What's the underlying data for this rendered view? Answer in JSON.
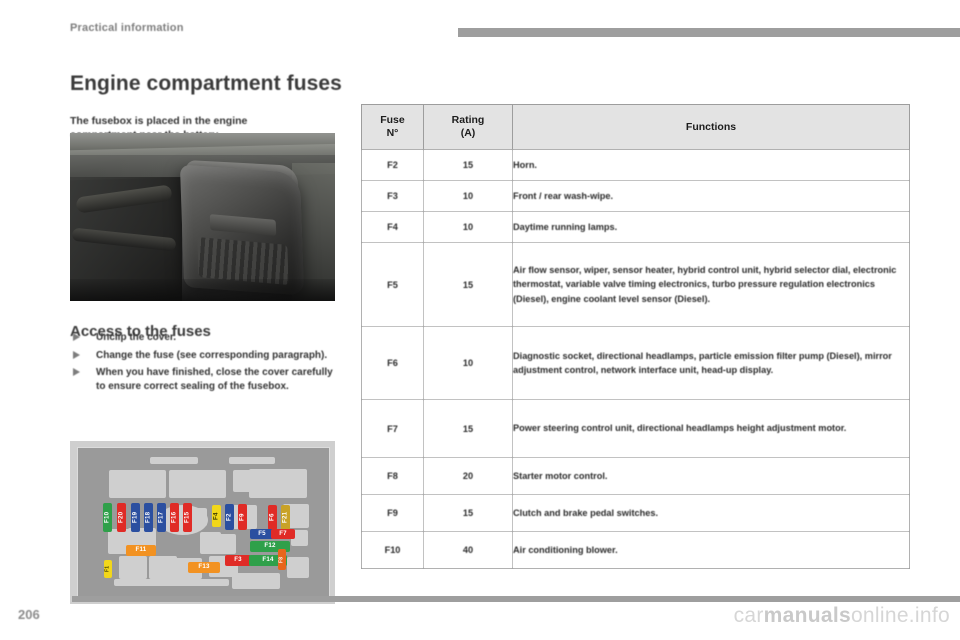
{
  "header": {
    "running_head": "Practical information"
  },
  "page": {
    "title": "Engine compartment fuses",
    "intro": "The fusebox is placed in the engine compartment near the battery.",
    "number": "206"
  },
  "access_section": {
    "title": "Access to the fuses",
    "steps": [
      "Unclip the cover.",
      "Change the fuse (see corresponding paragraph).",
      "When you have finished, close the cover carefully to ensure correct sealing of the fusebox."
    ]
  },
  "fusebox_diagram": {
    "caption": "",
    "fuses": [
      {
        "id": "F10",
        "color": "#2fa04a"
      },
      {
        "id": "F20",
        "color": "#e02b26"
      },
      {
        "id": "F19",
        "color": "#2b4fa0"
      },
      {
        "id": "F18",
        "color": "#2b4fa0"
      },
      {
        "id": "F17",
        "color": "#2b4fa0"
      },
      {
        "id": "F16",
        "color": "#e02b26"
      },
      {
        "id": "F15",
        "color": "#e02b26"
      },
      {
        "id": "F4",
        "color": "#f2d71a"
      },
      {
        "id": "F2",
        "color": "#2b4fa0"
      },
      {
        "id": "F9",
        "color": "#e02b26"
      },
      {
        "id": "F6",
        "color": "#e02b26"
      },
      {
        "id": "F21",
        "color": "#c9a227"
      },
      {
        "id": "F5",
        "color": "#2b4fa0"
      },
      {
        "id": "F7",
        "color": "#e02b26"
      },
      {
        "id": "F12",
        "color": "#2fa04a"
      },
      {
        "id": "F3",
        "color": "#e02b26"
      },
      {
        "id": "F14",
        "color": "#2fa04a"
      },
      {
        "id": "F8",
        "color": "#e8661c"
      },
      {
        "id": "F11",
        "color": "#f29222"
      },
      {
        "id": "F1",
        "color": "#f2d71a"
      },
      {
        "id": "F13",
        "color": "#f29222"
      }
    ]
  },
  "table": {
    "headers": {
      "fuse": "Fuse\nN°",
      "fuse_line1": "Fuse",
      "fuse_line2": "N°",
      "rating_line1": "Rating",
      "rating_line2": "(A)",
      "functions": "Functions"
    },
    "rows": [
      {
        "fuse": "F2",
        "rating": "15",
        "functions": "Horn."
      },
      {
        "fuse": "F3",
        "rating": "10",
        "functions": "Front / rear wash-wipe."
      },
      {
        "fuse": "F4",
        "rating": "10",
        "functions": "Daytime running lamps."
      },
      {
        "fuse": "F5",
        "rating": "15",
        "functions": "Air flow sensor, wiper, sensor heater, hybrid control unit, hybrid selector dial, electronic thermostat, variable valve timing electronics, turbo pressure regulation electronics (Diesel), engine coolant level sensor (Diesel)."
      },
      {
        "fuse": "F6",
        "rating": "10",
        "functions": "Diagnostic socket, directional headlamps, particle emission filter pump (Diesel), mirror adjustment control, network interface unit, head-up display."
      },
      {
        "fuse": "F7",
        "rating": "15",
        "functions": "Power steering control unit, directional headlamps height adjustment motor."
      },
      {
        "fuse": "F8",
        "rating": "20",
        "functions": "Starter motor control."
      },
      {
        "fuse": "F9",
        "rating": "15",
        "functions": "Clutch and brake pedal switches."
      },
      {
        "fuse": "F10",
        "rating": "40",
        "functions": "Air conditioning blower."
      }
    ]
  },
  "watermark": {
    "prefix": "car",
    "bold": "manuals",
    "suffix": "online.info"
  }
}
